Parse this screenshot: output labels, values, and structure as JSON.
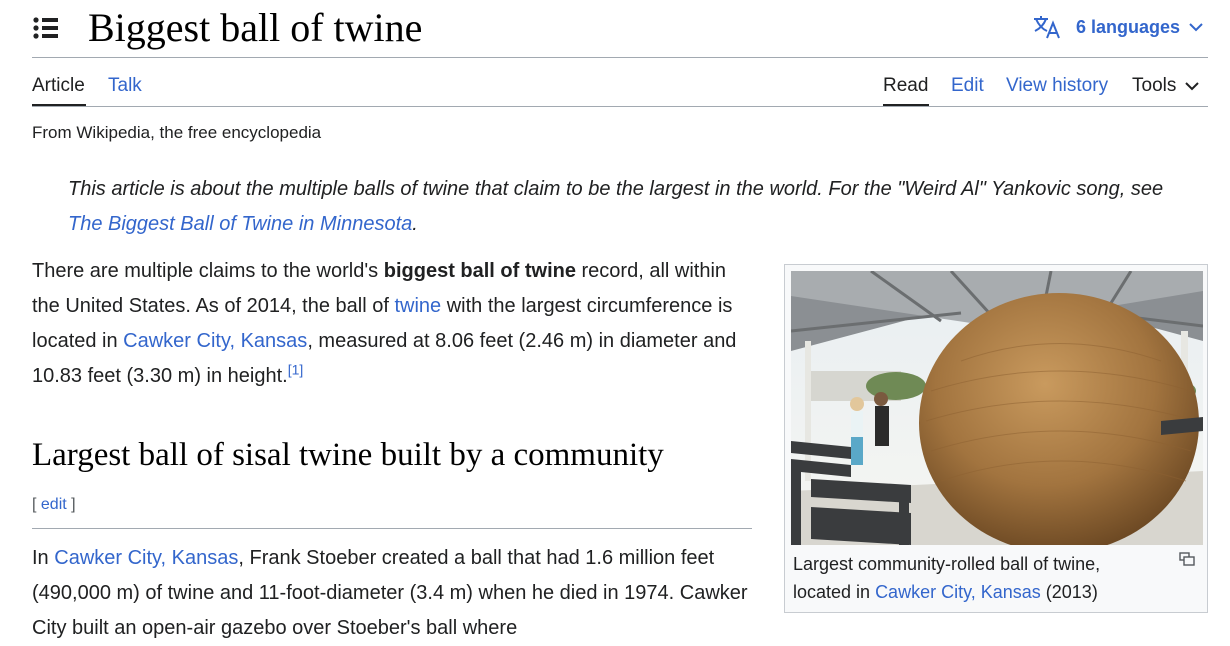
{
  "header": {
    "title": "Biggest ball of twine",
    "languages_label": "6 languages"
  },
  "tabs": {
    "article": "Article",
    "talk": "Talk",
    "read": "Read",
    "edit": "Edit",
    "view_history": "View history",
    "tools": "Tools"
  },
  "tagline": "From Wikipedia, the free encyclopedia",
  "hatnote": {
    "text": "This article is about the multiple balls of twine that claim to be the largest in the world. For the \"Weird Al\" Yankovic song, see ",
    "link": "The Biggest Ball of Twine in Minnesota",
    "end": "."
  },
  "intro": {
    "t1": "There are multiple claims to the world's ",
    "bold": "biggest ball of twine",
    "t2": " record, all within the United States. As of 2014, the ball of ",
    "link_twine": "twine",
    "t3": " with the largest circumference is located in ",
    "link_cawker": "Cawker City, Kansas",
    "t4": ", measured at 8.06 feet (2.46 m) in diameter and 10.83 feet (3.30 m) in height.",
    "ref": "[1]"
  },
  "section": {
    "heading": "Largest ball of sisal twine built by a community",
    "edit_open": "[ ",
    "edit_label": "edit",
    "edit_close": " ]",
    "p_t1": "In ",
    "p_link": "Cawker City, Kansas",
    "p_t2": ", Frank Stoeber created a ball that had 1.6 million feet (490,000 m) of twine and 11-foot-diameter (3.4 m) when he died in 1974. Cawker City built an open-air gazebo over Stoeber's ball where"
  },
  "thumbnail": {
    "caption_t1": "Largest community-rolled ball of twine, located in ",
    "caption_link": "Cawker City, Kansas",
    "caption_t2": " (2013)"
  },
  "colors": {
    "link": "#3366cc",
    "text": "#202122",
    "rule": "#a2a9b1"
  }
}
